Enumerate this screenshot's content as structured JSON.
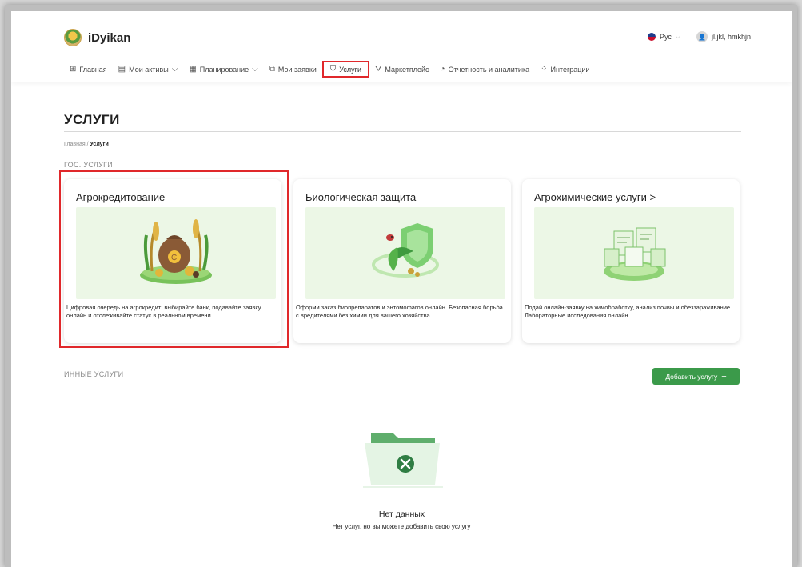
{
  "app": {
    "name": "iDyikan"
  },
  "header": {
    "language": "Рус",
    "user_name": "jl.jkl, hmkhjn"
  },
  "nav": [
    {
      "label": "Главная",
      "icon": "grid-icon"
    },
    {
      "label": "Мои активы",
      "icon": "asset-icon",
      "dropdown": true
    },
    {
      "label": "Планирование",
      "icon": "calendar-icon",
      "dropdown": true
    },
    {
      "label": "Мои заявки",
      "icon": "copy-icon"
    },
    {
      "label": "Услуги",
      "icon": "bag-icon",
      "active": true
    },
    {
      "label": "Маркетплейс",
      "icon": "cart-icon"
    },
    {
      "label": "Отчетность и аналитика",
      "icon": "chart-icon"
    },
    {
      "label": "Интеграции",
      "icon": "integration-icon"
    }
  ],
  "page": {
    "title": "УСЛУГИ",
    "breadcrumb_home": "Главная",
    "breadcrumb_sep": "/",
    "breadcrumb_current": "Услуги",
    "gov_section_label": "ГОС. УСЛУГИ",
    "other_section_label": "ИННЫЕ УСЛУГИ",
    "add_button_label": "Добавить услугу",
    "empty_title": "Нет данных",
    "empty_description": "Нет услуг, но вы можете добавить свою услугу"
  },
  "cards": [
    {
      "title": "Агрокредитование",
      "description": "Цифровая очередь на агрокредит: выбирайте банк, подавайте заявку онлайн и отслеживайте статус в реальном времени."
    },
    {
      "title": "Биологическая защита",
      "description": "Оформи заказ биопрепаратов и энтомофагов онлайн. Безопасная борьба с вредителями без химии для вашего хозяйства."
    },
    {
      "title": "Агрохимические услуги >",
      "description": "Подай онлайн-заявку на химобработку, анализ почвы и обеззараживание. Лабораторные исследования онлайн."
    }
  ],
  "colors": {
    "accent_green": "#3b9a4a",
    "highlight_red": "#e0282b",
    "card_image_bg": "#ecf7e6"
  }
}
